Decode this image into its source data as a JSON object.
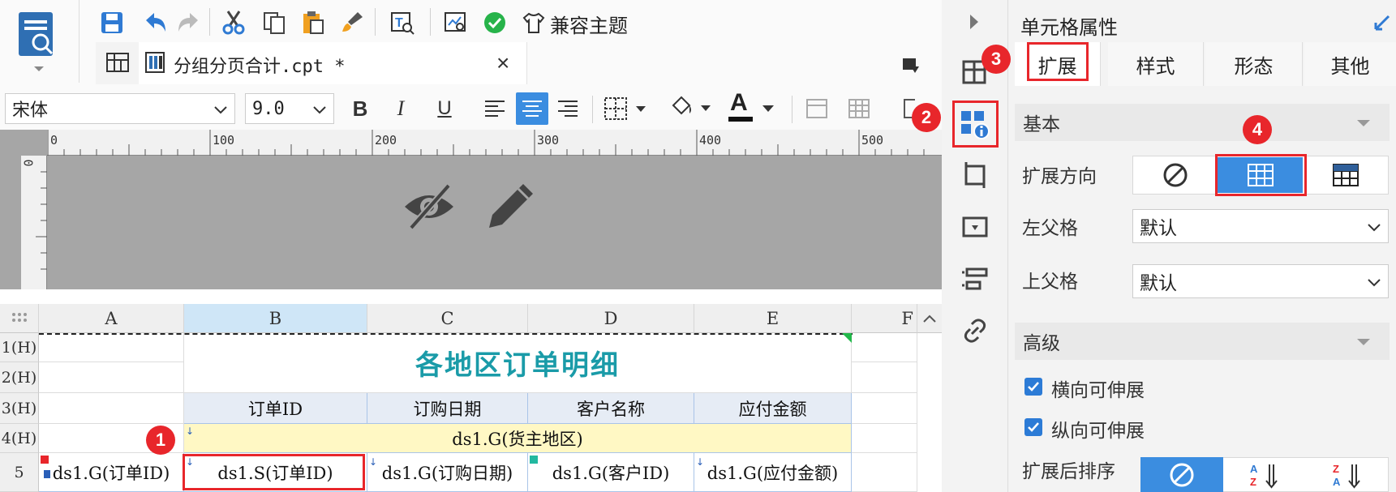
{
  "toolbar": {
    "compat_theme_label": "兼容主题",
    "font_name": "宋体",
    "font_size": "9.0",
    "bold_label": "B",
    "italic_label": "I",
    "underline_label": "U",
    "font_color_label": "A"
  },
  "document_tab": {
    "title": "分组分页合计.cpt *",
    "close": "×"
  },
  "ruler": {
    "h_ticks": [
      "0",
      "100",
      "200",
      "300",
      "400",
      "500"
    ],
    "v_tick": "0"
  },
  "grid": {
    "columns": [
      "A",
      "B",
      "C",
      "D",
      "E",
      "F"
    ],
    "rows": [
      "1(H)",
      "2(H)",
      "3(H)",
      "4(H)",
      "5"
    ],
    "title": "各地区订单明细",
    "headers": [
      "订单ID",
      "订购日期",
      "客户名称",
      "应付金额"
    ],
    "group_cell": "ds1.G(货主地区)",
    "row5": [
      "ds1.G(订单ID)",
      "ds1.S(订单ID)",
      "ds1.G(订购日期)",
      "ds1.G(客户ID)",
      "ds1.G(应付金额)"
    ]
  },
  "properties": {
    "title": "单元格属性",
    "tabs": [
      "扩展",
      "样式",
      "形态",
      "其他"
    ],
    "basic_section": "基本",
    "expand_direction_label": "扩展方向",
    "left_parent_label": "左父格",
    "left_parent_value": "默认",
    "top_parent_label": "上父格",
    "top_parent_value": "默认",
    "advanced_section": "高级",
    "horizontal_expandable": "横向可伸展",
    "vertical_expandable": "纵向可伸展",
    "sort_after_expand_label": "扩展后排序"
  },
  "badges": [
    "1",
    "2",
    "3",
    "4"
  ],
  "colors": {
    "accent": "#3b8de0",
    "highlight": "#e8262b",
    "title_teal": "#1a9ba8",
    "group_yellow": "#fff8c4"
  }
}
